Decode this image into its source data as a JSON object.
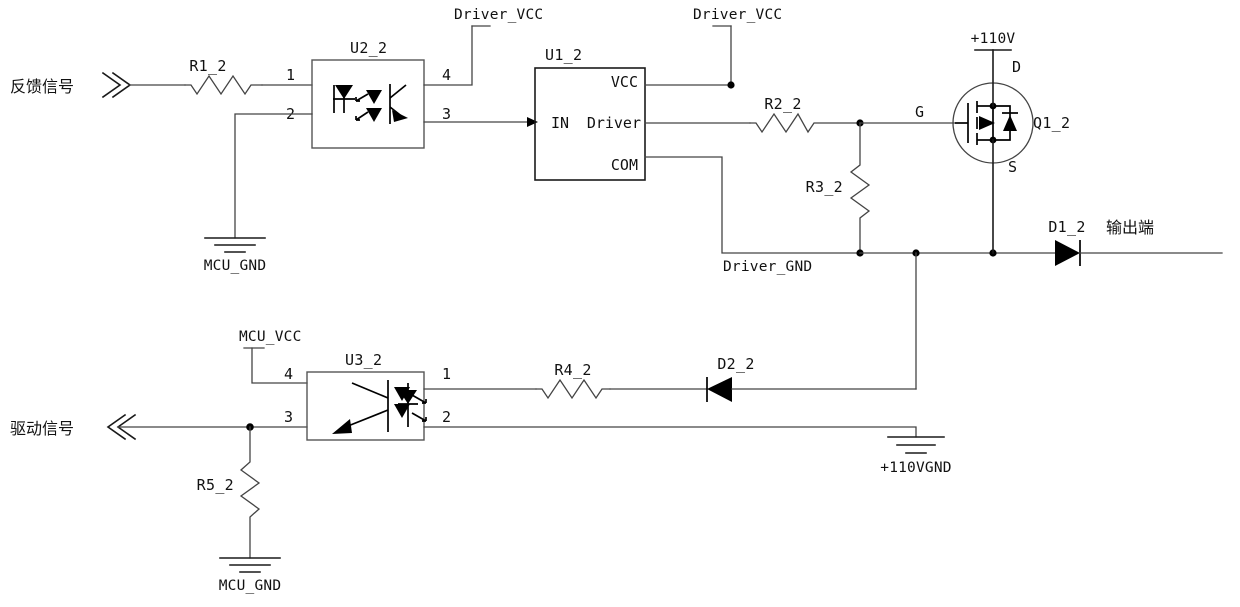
{
  "diagram": {
    "title": "",
    "type": "schematic",
    "background": "#ffffff",
    "line_color": "#1a1a1a"
  },
  "ports": {
    "feedback_in": "反馈信号",
    "drive_in": "驱动信号",
    "output": "输出端"
  },
  "nets": {
    "driver_vcc_1": "Driver_VCC",
    "driver_vcc_2": "Driver_VCC",
    "driver_gnd": "Driver_GND",
    "mcu_gnd_1": "MCU_GND",
    "mcu_gnd_2": "MCU_GND",
    "mcu_vcc": "MCU_VCC",
    "hv_rail": "+110V",
    "hv_gnd": "+110VGND"
  },
  "components": {
    "r1": {
      "ref": "R1_2",
      "type": "resistor"
    },
    "r2": {
      "ref": "R2_2",
      "type": "resistor"
    },
    "r3": {
      "ref": "R3_2",
      "type": "resistor"
    },
    "r4": {
      "ref": "R4_2",
      "type": "resistor"
    },
    "r5": {
      "ref": "R5_2",
      "type": "resistor"
    },
    "u1": {
      "ref": "U1_2",
      "type": "gate-driver"
    },
    "u2": {
      "ref": "U2_2",
      "type": "optocoupler"
    },
    "u3": {
      "ref": "U3_2",
      "type": "optocoupler"
    },
    "q1": {
      "ref": "Q1_2",
      "type": "mosfet"
    },
    "d1": {
      "ref": "D1_2",
      "type": "diode"
    },
    "d2": {
      "ref": "D2_2",
      "type": "diode"
    }
  },
  "pins": {
    "u1": {
      "in": "IN",
      "vcc": "VCC",
      "driver": "Driver",
      "com": "COM"
    },
    "u2": {
      "p1": "1",
      "p2": "2",
      "p3": "3",
      "p4": "4"
    },
    "u3": {
      "p1": "1",
      "p2": "2",
      "p3": "3",
      "p4": "4"
    },
    "q1": {
      "d": "D",
      "g": "G",
      "s": "S"
    }
  }
}
